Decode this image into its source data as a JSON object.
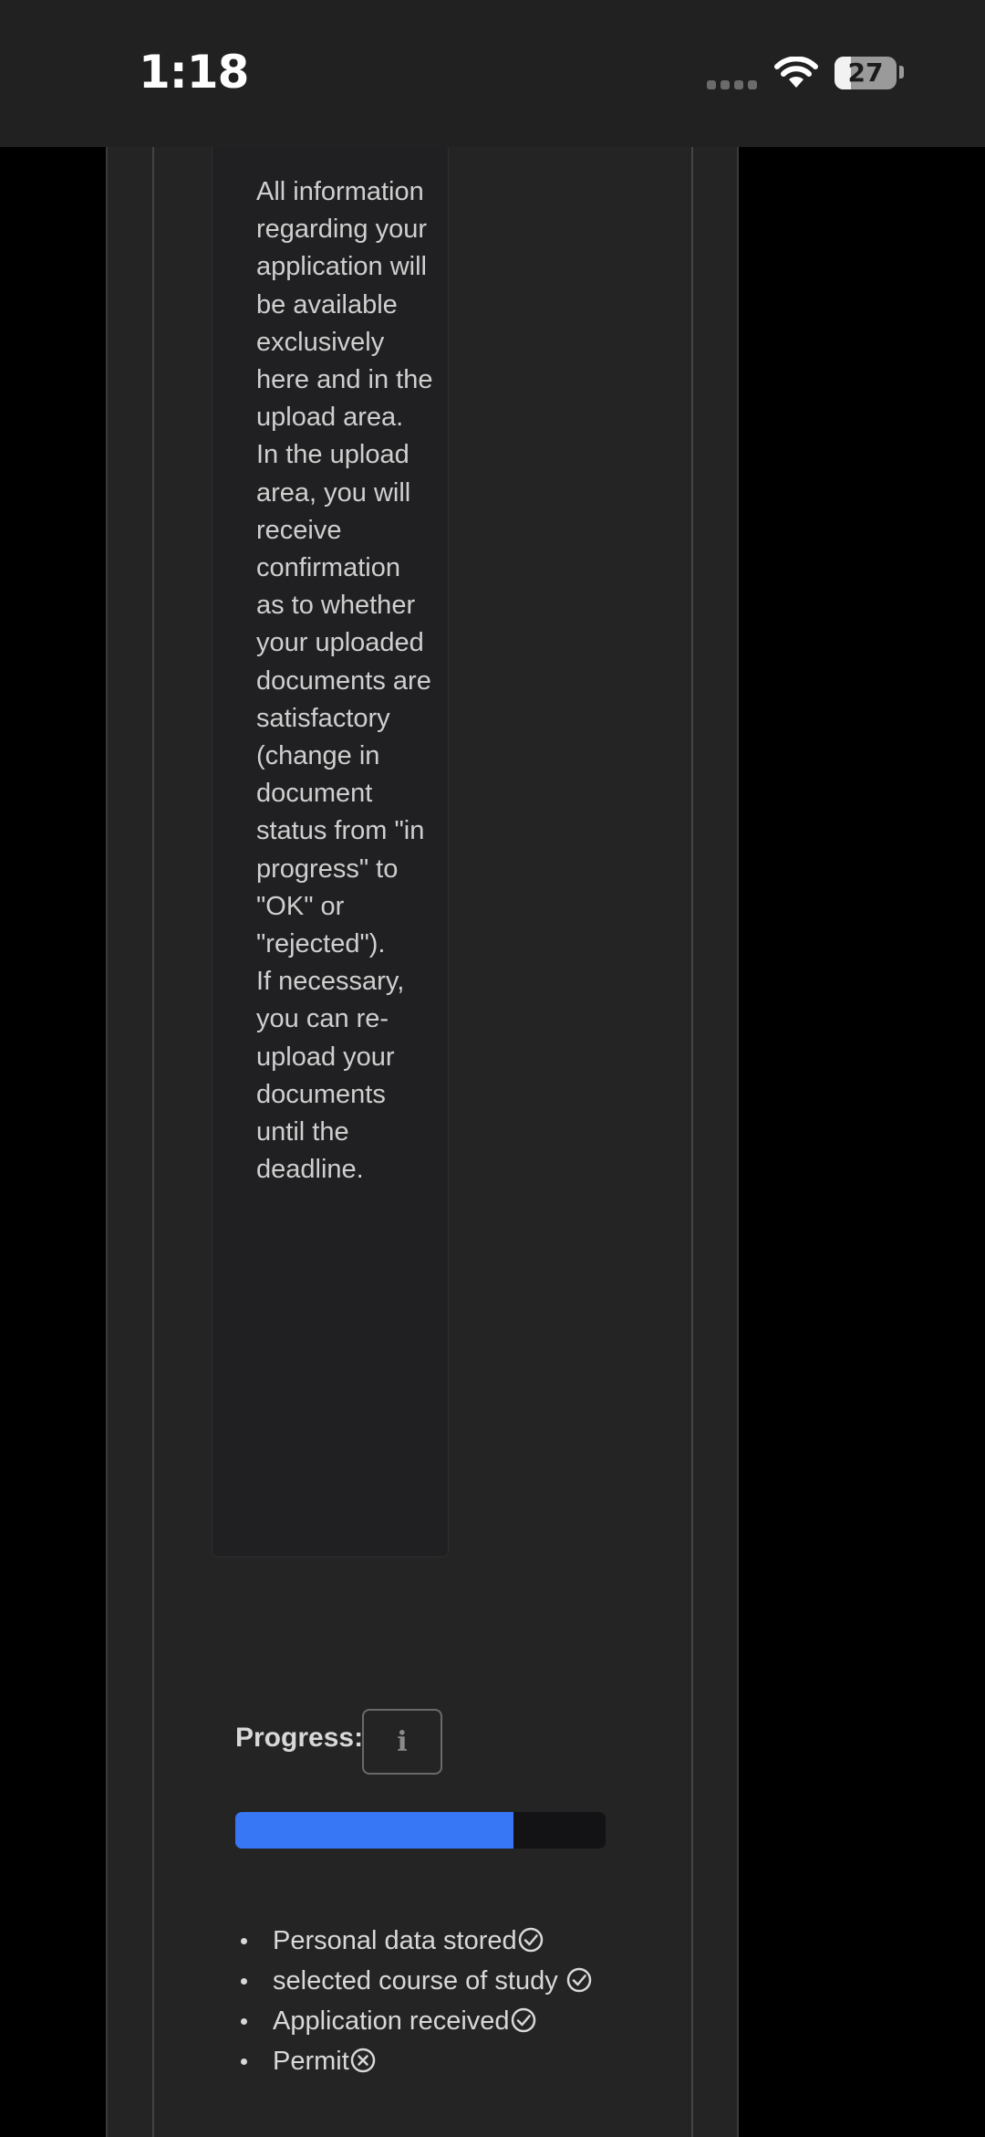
{
  "status_bar": {
    "time": "1:18",
    "battery": "27",
    "battery_level": 0.27,
    "icons": [
      "signal-icon",
      "wifi-icon",
      "battery-icon"
    ]
  },
  "info": {
    "paragraphs": [
      "All information regarding your application will be available exclusively here and in the upload area.",
      "In the upload area, you will receive confirmation as to whether your uploaded documents are satisfactory (change in document status from \"in progress\" to \"OK\" or \"rejected\").",
      "If necessary, you can re-upload your documents until the deadline."
    ]
  },
  "progress": {
    "label": "Progress:",
    "info_icon": "i",
    "value": 0.75,
    "color": "#3777f5"
  },
  "checklist": [
    {
      "label": "Personal data stored",
      "status": "done",
      "icon": "check-circle-icon"
    },
    {
      "label": "selected course of study",
      "status": "done",
      "icon": "check-circle-icon"
    },
    {
      "label": "Application received",
      "status": "done",
      "icon": "check-circle-icon"
    },
    {
      "label": "Permit",
      "status": "not-done",
      "icon": "x-circle-icon"
    }
  ]
}
